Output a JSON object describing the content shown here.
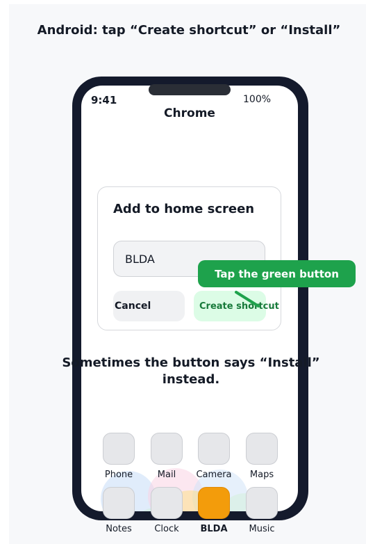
{
  "heading": "Android: tap “Create shortcut” or “Install”",
  "status_bar": {
    "time": "9:41",
    "battery": "100%"
  },
  "browser": {
    "title": "Chrome"
  },
  "dialog": {
    "title": "Add to home screen",
    "name_value": "BLDA",
    "cancel_label": "Cancel",
    "create_label": "Create shortcut"
  },
  "callout": {
    "text": "Tap the green button"
  },
  "note": "Sometimes the button says “Install” instead.",
  "home_apps": [
    {
      "label": "Phone",
      "icon": "phone-app-icon"
    },
    {
      "label": "Mail",
      "icon": "mail-app-icon"
    },
    {
      "label": "Camera",
      "icon": "camera-app-icon"
    },
    {
      "label": "Maps",
      "icon": "maps-app-icon"
    },
    {
      "label": "Notes",
      "icon": "notes-app-icon"
    },
    {
      "label": "Clock",
      "icon": "clock-app-icon"
    },
    {
      "label": "BLDA",
      "icon": "blda-app-icon",
      "highlight": true
    },
    {
      "label": "Music",
      "icon": "music-app-icon"
    }
  ],
  "colors": {
    "accent": "#1ea24c",
    "highlight_app": "#f39c0b",
    "phone_frame": "#141a2c"
  }
}
